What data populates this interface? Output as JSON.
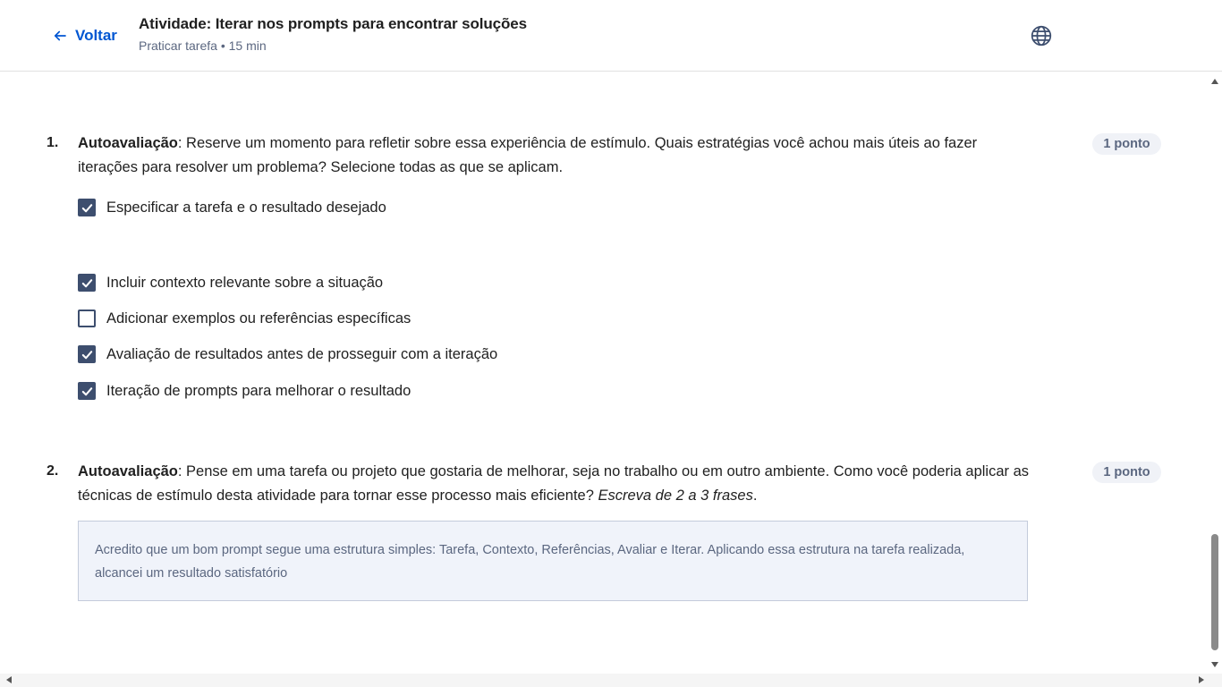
{
  "header": {
    "back_label": "Voltar",
    "title": "Atividade: Iterar nos prompts para encontrar soluções",
    "subtitle": "Praticar tarefa • 15 min"
  },
  "questions": [
    {
      "number": "1.",
      "label_bold": "Autoavaliação",
      "text": ": Reserve um momento para refletir sobre essa experiência de estímulo. Quais estratégias você achou mais úteis ao fazer iterações para resolver um problema? Selecione todas as que se aplicam.",
      "points": "1 ponto",
      "options": [
        {
          "label": "Especificar a tarefa e o resultado desejado",
          "checked": true
        },
        {
          "label": "Incluir contexto relevante sobre a situação",
          "checked": true
        },
        {
          "label": "Adicionar exemplos ou referências específicas",
          "checked": false
        },
        {
          "label": "Avaliação de resultados antes de prosseguir com a iteração",
          "checked": true
        },
        {
          "label": "Iteração de prompts para melhorar o resultado",
          "checked": true
        }
      ]
    },
    {
      "number": "2.",
      "label_bold": "Autoavaliação",
      "text": ": Pense em uma tarefa ou projeto que gostaria de melhorar, seja no trabalho ou em outro ambiente. Como você poderia aplicar as técnicas de estímulo desta atividade para tornar esse processo mais eficiente? ",
      "text_italic": "Escreva de 2 a 3 frases",
      "text_end": ".",
      "points": "1 ponto",
      "answer": "Acredito que um bom prompt segue uma estrutura simples: Tarefa, Contexto, Referências, Avaliar e Iterar. Aplicando essa estrutura na tarefa realizada, alcancei um resultado satisfatório"
    }
  ],
  "colors": {
    "accent": "#0056d2",
    "checkbox": "#3d4e6e",
    "badge_bg": "#f0f2f7",
    "answer_bg": "#f0f3fa"
  },
  "icons": [
    "arrow-left-icon",
    "globe-icon",
    "checkmark-icon"
  ]
}
